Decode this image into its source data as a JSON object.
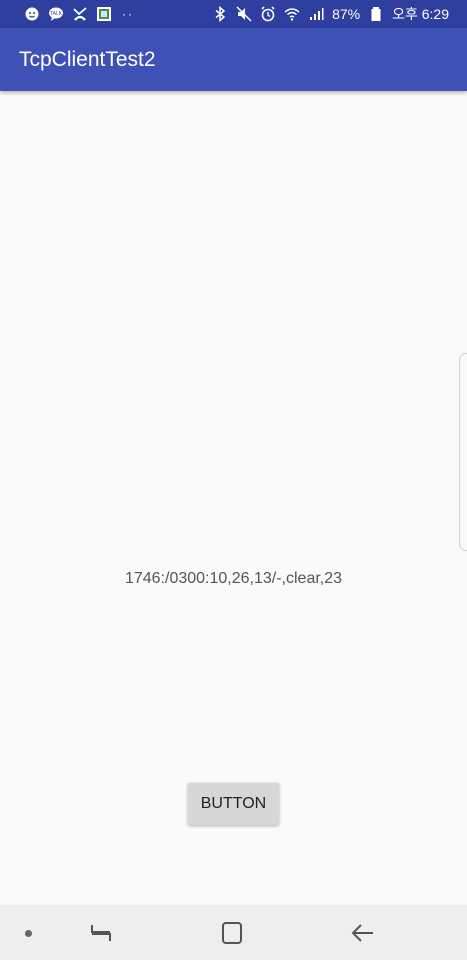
{
  "status_bar": {
    "icons_left": [
      "cloud-face-icon",
      "talk-bubble-icon",
      "missed-call-icon",
      "gallery-icon"
    ],
    "overflow_dots": "··",
    "icons_right": [
      "bluetooth-icon",
      "mute-icon",
      "alarm-icon",
      "wifi-icon",
      "signal-icon"
    ],
    "battery_percent": "87%",
    "battery_icon": "battery-icon",
    "time": "오후 6:29",
    "background_color": "#2f3f9f"
  },
  "app_bar": {
    "title": "TcpClientTest2",
    "color": "#3f51b5"
  },
  "main": {
    "message": "1746:/0300:10,26,13/-,clear,23",
    "button_label": "BUTTON"
  },
  "nav_bar": {
    "items": [
      "dot-icon",
      "recent-apps-icon",
      "home-icon",
      "back-icon"
    ]
  }
}
